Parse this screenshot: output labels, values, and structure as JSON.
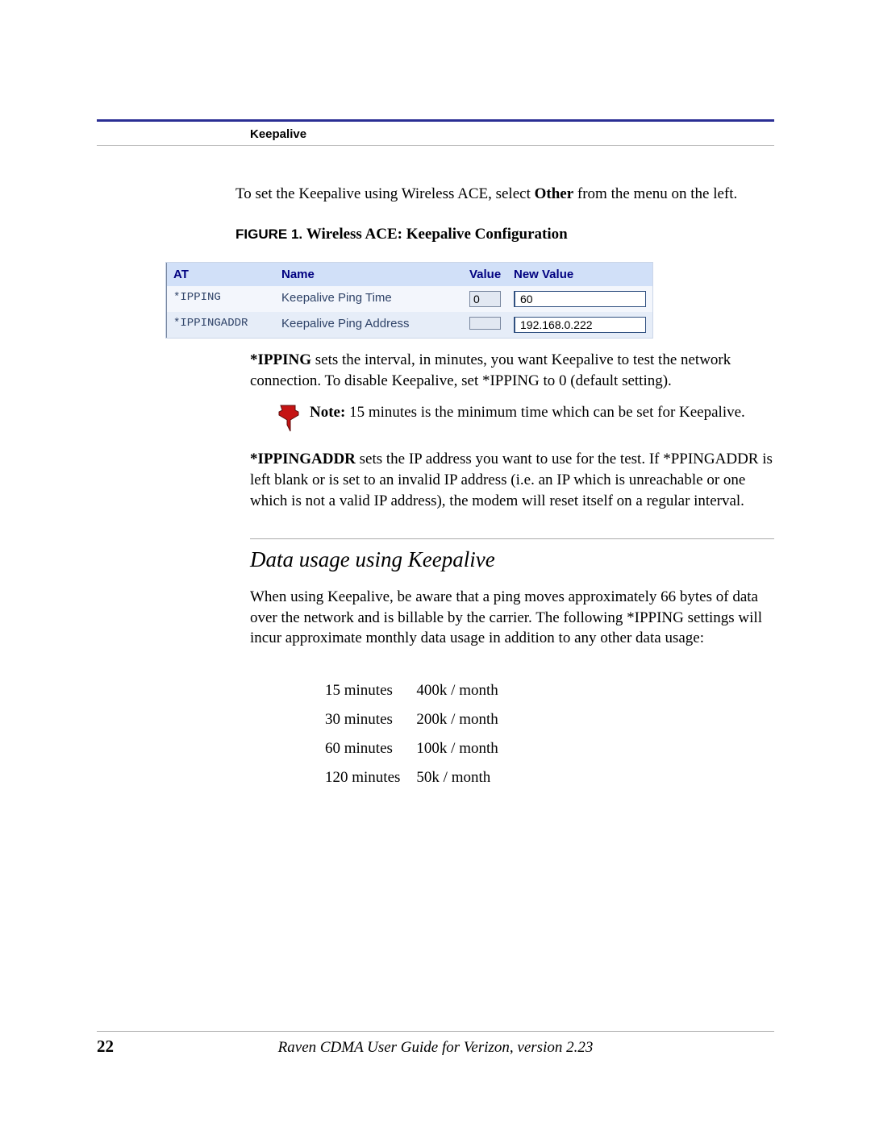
{
  "header": {
    "section_label": "Keepalive"
  },
  "intro": {
    "prefix": "To set the Keepalive using Wireless ACE, select ",
    "bold": "Other",
    "suffix": " from the menu on the left."
  },
  "figure": {
    "label": "FIGURE 1.  ",
    "caption": "Wireless ACE: Keepalive Configuration"
  },
  "config_table": {
    "headers": {
      "at": "AT",
      "name": "Name",
      "value": "Value",
      "new_value": "New Value"
    },
    "rows": [
      {
        "at": "*IPPING",
        "name": "Keepalive Ping Time",
        "value": "0",
        "new_value": "60"
      },
      {
        "at": "*IPPINGADDR",
        "name": "Keepalive Ping Address",
        "value": "",
        "new_value": "192.168.0.222"
      }
    ]
  },
  "ipping_para": {
    "bold": "*IPPING",
    "text": " sets the interval, in minutes, you want Keepalive to test the network connection.  To disable Keepalive, set *IPPING to 0 (default setting)."
  },
  "note": {
    "bold": "Note:",
    "text": " 15 minutes is the minimum time which can be set for Keepalive."
  },
  "ippingaddr_para": {
    "bold": "*IPPINGADDR",
    "text": " sets the IP address you want to use for the test.  If *PPINGADDR is left blank or is set to an invalid IP address (i.e. an IP which is unreachable or one which is not a valid IP address), the modem will reset itself on a regular interval."
  },
  "subsection": {
    "title": "Data usage using Keepalive",
    "para": "When using Keepalive, be aware that a ping moves approximately 66 bytes of data over the network and is billable by the carrier.   The following *IPPING settings will incur approximate monthly data usage in addition to any other data usage:"
  },
  "usage": [
    {
      "interval": "15 minutes",
      "usage": "400k / month"
    },
    {
      "interval": "30 minutes",
      "usage": "200k / month"
    },
    {
      "interval": "60 minutes",
      "usage": "100k / month"
    },
    {
      "interval": "120 minutes",
      "usage": "50k / month"
    }
  ],
  "footer": {
    "page_number": "22",
    "doc_title": "Raven CDMA User Guide for Verizon, version 2.23"
  }
}
